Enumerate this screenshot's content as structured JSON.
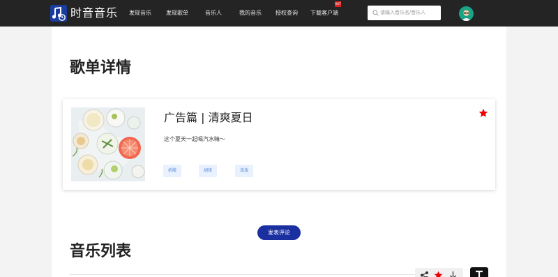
{
  "header": {
    "brand": "时音音乐",
    "nav": [
      "发现音乐",
      "发现歌单",
      "音乐人",
      "我的音乐",
      "授权查询",
      "下载客户端"
    ],
    "hot_badge": "HOT",
    "search_placeholder": "请输入音乐名/音乐人"
  },
  "detail": {
    "section_title": "歌单详情",
    "name": "广告篇 | 清爽夏日",
    "description": "这个夏天一起喝汽水嘛～",
    "tags": [
      "析陂",
      "胡抹",
      "活泼"
    ]
  },
  "actions": {
    "comment_button": "发表评论"
  },
  "music_list": {
    "section_title": "音乐列表"
  },
  "colors": {
    "nav_bg": "#242424",
    "accent": "#1a2fa0",
    "favorite": "#ee0000",
    "tag_bg": "#e8f1fd",
    "tag_text": "#5a8dd6"
  }
}
